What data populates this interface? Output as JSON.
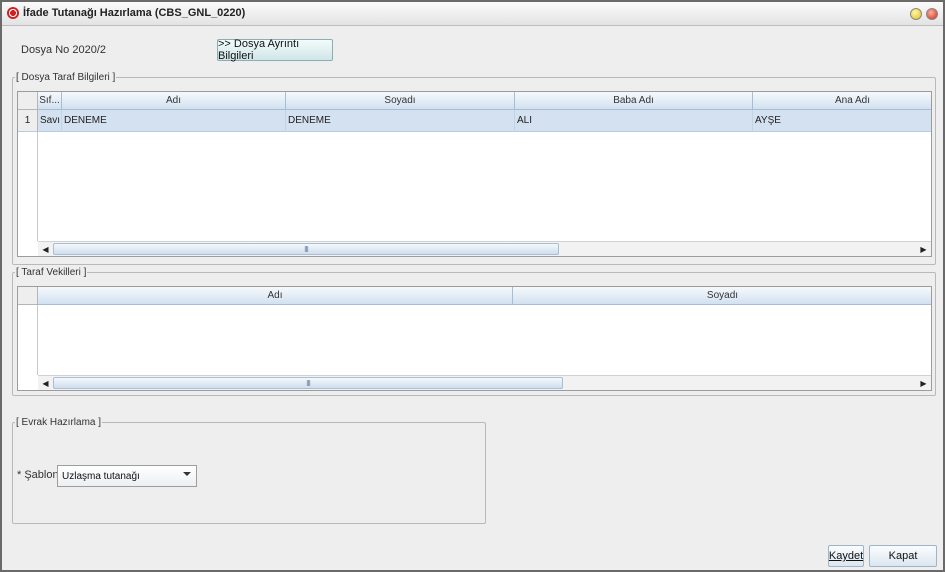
{
  "window": {
    "title": "İfade Tutanağı Hazırlama (CBS_GNL_0220)"
  },
  "header": {
    "dosya_no_label": "Dosya No 2020/2",
    "detail_button_label": ">> Dosya Ayrıntı Bilgileri"
  },
  "parties": {
    "legend": "[ Dosya Taraf Bilgileri ]",
    "columns": [
      "Sıf...",
      "Adı",
      "Soyadı",
      "Baba Adı",
      "Ana Adı"
    ],
    "rows": [
      {
        "no": "1",
        "sifat": "Savı",
        "adi": "DENEME",
        "soyadi": "DENEME",
        "baba_adi": "ALI",
        "ana_adi": "AYŞE"
      }
    ],
    "scroll_thumb_glyph": "III"
  },
  "attorneys": {
    "legend": "[ Taraf Vekilleri ]",
    "columns": [
      "Adı",
      "Soyadı"
    ],
    "scroll_thumb_glyph": "III"
  },
  "document": {
    "legend": "[ Evrak Hazırlama ]",
    "template_label": "* Şablon",
    "template_value": "Uzlaşma tutanağı"
  },
  "footer": {
    "save_label": "Kaydet",
    "cancel_label": "Kapat"
  },
  "icons": {
    "app": "app-logo-icon",
    "minimize": "minimize-icon",
    "close": "close-icon",
    "scroll_left": "arrow-left-icon",
    "scroll_right": "arrow-right-icon",
    "dropdown": "chevron-down-icon"
  },
  "colors": {
    "header_blue": "#d2e1f0",
    "selected_row": "#d3e1f0",
    "close_button": "#d02a14",
    "minimize_button": "#e3bd12"
  }
}
